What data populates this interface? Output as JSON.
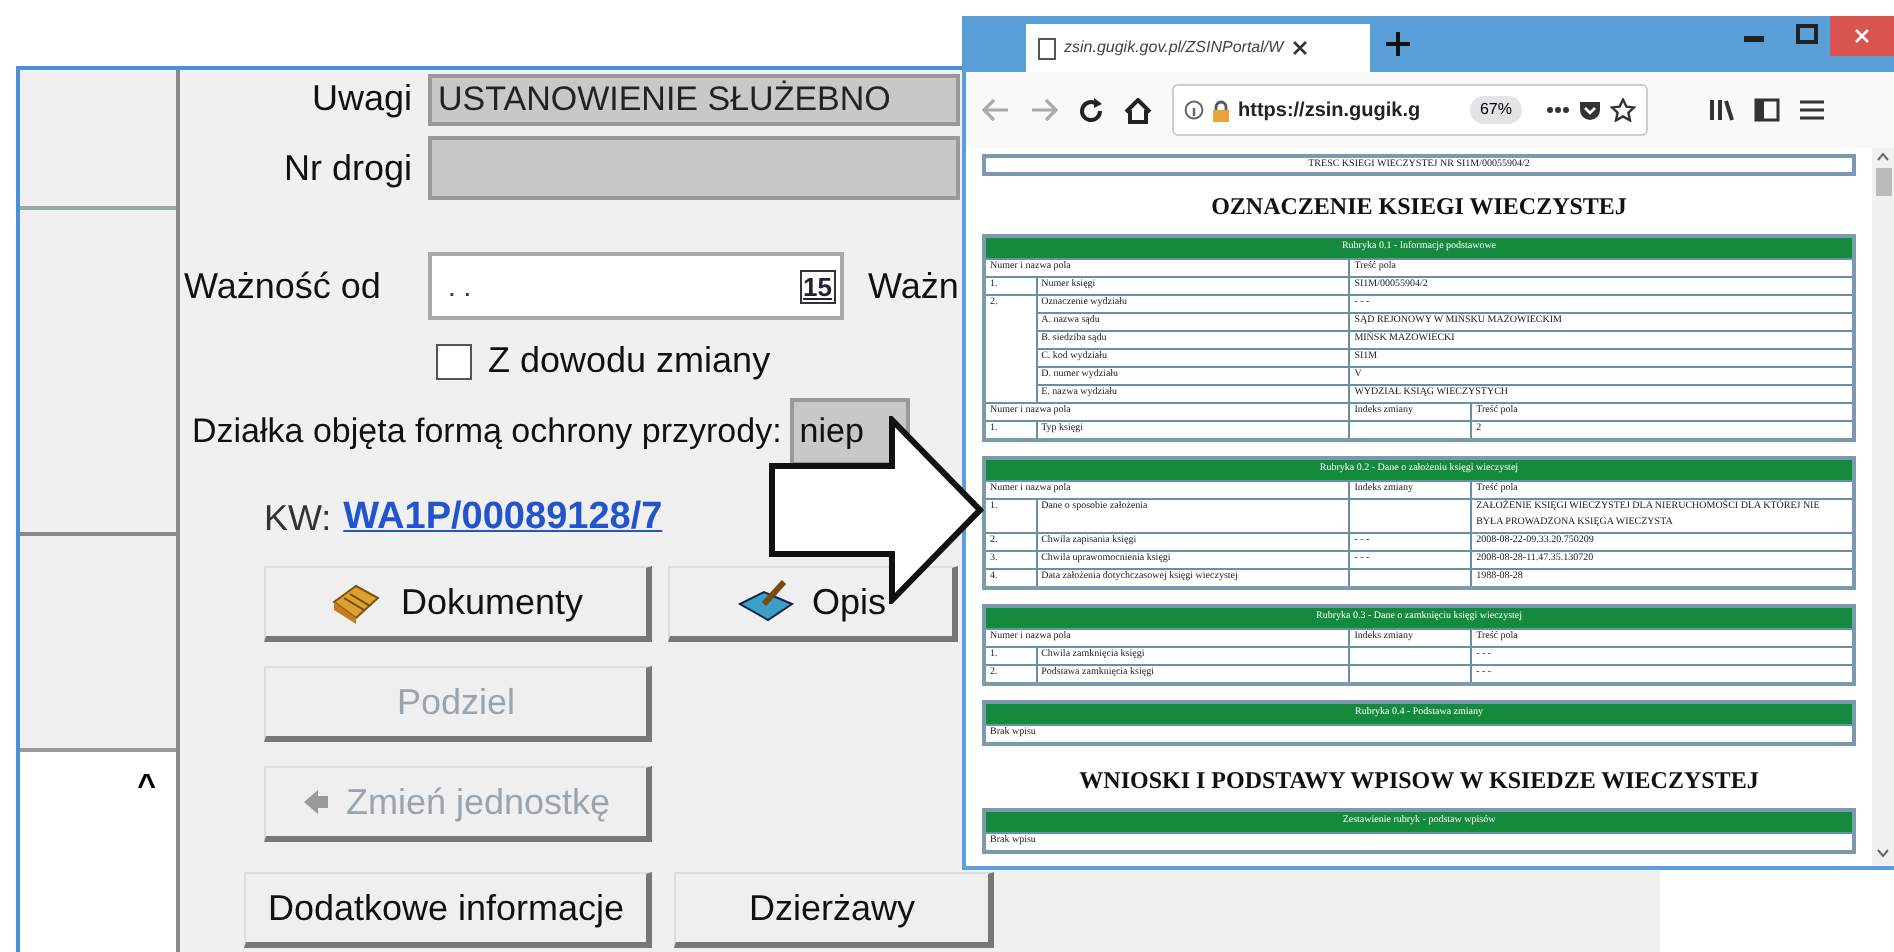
{
  "app": {
    "form": {
      "uwagi": {
        "label": "Uwagi",
        "value": "USTANOWIENIE SŁUŻEBNO"
      },
      "nr_drogi": {
        "label": "Nr drogi"
      },
      "waznosc_od": {
        "label": "Ważność od",
        "value": ". .",
        "calendar": "15"
      },
      "waznosc_do": {
        "label": "Ważn"
      },
      "z_dowodu_zmiany": {
        "label": "Z dowodu zmiany",
        "checked": false
      },
      "ochrona_przyrody": {
        "label": "Działka objęta formą ochrony przyrody:",
        "value": "niep"
      },
      "kw": {
        "label": "KW:",
        "link": "WA1P/00089128/7"
      }
    },
    "buttons": [
      {
        "label": "Dokumenty",
        "disabled": false
      },
      {
        "label": "Opis",
        "disabled": false
      },
      {
        "label": "Podziel",
        "disabled": true
      },
      {
        "label": "Zmień jednostkę",
        "disabled": true
      },
      {
        "label": "Dodatkowe informacje",
        "disabled": false
      },
      {
        "label": "Dzierżawy",
        "disabled": false
      }
    ],
    "side_scroll": "^"
  },
  "browser": {
    "tab_title": "zsin.gugik.gov.pl/ZSINPortal/W",
    "url": "https://zsin.gugik.g",
    "zoom": "67%",
    "document": [
      {
        "kind": "caption",
        "text": "TRESC KSIEGI WIECZYSTEJ NR SI1M/00055904/2"
      },
      {
        "kind": "heading",
        "text": "OZNACZENIE KSIEGI WIECZYSTEJ"
      },
      {
        "kind": "table",
        "title": "Rubryka 0.1 - Informacje podstawowe",
        "rows": [
          [
            {
              "text": "Numer i nazwa pola",
              "colspan": 2
            },
            {
              "text": "Treść pola",
              "colspan": 2
            }
          ],
          [
            {
              "text": "1."
            },
            {
              "text": "Numer księgi"
            },
            {
              "text": "SI1M/00055904/2",
              "colspan": 2
            }
          ],
          [
            {
              "text": "2.",
              "rowspan": 6
            },
            {
              "text": "Oznaczenie wydziału"
            },
            {
              "text": "- - -",
              "colspan": 2
            }
          ],
          [
            {
              "text": "A. nazwa sądu"
            },
            {
              "text": "SĄD REJONOWY W MIŃSKU MAZOWIECKIM",
              "colspan": 2
            }
          ],
          [
            {
              "text": "B. siedziba sądu"
            },
            {
              "text": "MIŃSK MAZOWIECKI",
              "colspan": 2
            }
          ],
          [
            {
              "text": "C. kod wydziału"
            },
            {
              "text": "SI1M",
              "colspan": 2
            }
          ],
          [
            {
              "text": "D. numer wydziału"
            },
            {
              "text": "V",
              "colspan": 2
            }
          ],
          [
            {
              "text": "E. nazwa wydziału"
            },
            {
              "text": "WYDZIAŁ KSIĄG WIECZYSTYCH",
              "colspan": 2
            }
          ],
          [
            {
              "text": "Numer i nazwa pola",
              "colspan": 2
            },
            {
              "text": "Indeks zmiany"
            },
            {
              "text": "Treść pola"
            }
          ],
          [
            {
              "text": "1."
            },
            {
              "text": "Typ księgi"
            },
            {},
            {
              "text": "2"
            }
          ]
        ]
      },
      {
        "kind": "table",
        "title": "Rubryka 0.2 - Dane o założeniu księgi wieczystej",
        "rows": [
          [
            {
              "text": "Numer i nazwa pola",
              "colspan": 2
            },
            {
              "text": "Indeks zmiany"
            },
            {
              "text": "Treść pola"
            }
          ],
          [
            {
              "text": "1."
            },
            {
              "text": "Dane o sposobie założenia"
            },
            {},
            {
              "text": "ZAŁOŻENIE KSIĘGI WIECZYSTEJ DLA NIERUCHOMOŚCI DLA KTÓREJ NIE BYŁA PROWADZONA KSIĘGA WIECZYSTA"
            }
          ],
          [
            {
              "text": "2."
            },
            {
              "text": "Chwila zapisania księgi"
            },
            {
              "text": "- - -"
            },
            {
              "text": "2008-08-22-09.33.20.750209"
            }
          ],
          [
            {
              "text": "3."
            },
            {
              "text": "Chwila uprawomocnienia księgi"
            },
            {
              "text": "- - -"
            },
            {
              "text": "2008-08-28-11.47.35.130720"
            }
          ],
          [
            {
              "text": "4."
            },
            {
              "text": "Data założenia dotychczasowej księgi wieczystej"
            },
            {},
            {
              "text": "1988-08-28"
            }
          ]
        ]
      },
      {
        "kind": "table",
        "title": "Rubryka 0.3 - Dane o zamknięciu księgi wieczystej",
        "rows": [
          [
            {
              "text": "Numer i nazwa pola",
              "colspan": 2
            },
            {
              "text": "Indeks zmiany"
            },
            {
              "text": "Treść pola"
            }
          ],
          [
            {
              "text": "1."
            },
            {
              "text": "Chwila zamknięcia księgi"
            },
            {},
            {
              "text": "- - -"
            }
          ],
          [
            {
              "text": "2."
            },
            {
              "text": "Podstawa zamknięcia księgi"
            },
            {},
            {
              "text": "- - -"
            }
          ]
        ]
      },
      {
        "kind": "table",
        "title": "Rubryka 0.4 - Podstawa zmiany",
        "rows": [
          [
            {
              "text": "Brak wpisu",
              "colspan": 4
            }
          ]
        ]
      },
      {
        "kind": "heading",
        "text": "WNIOSKI I PODSTAWY WPISOW W KSIEDZE WIECZYSTEJ"
      },
      {
        "kind": "table",
        "title": "Zestawienie rubryk - podstaw wpisów",
        "rows": [
          [
            {
              "text": "Brak wpisu",
              "colspan": 4
            }
          ]
        ]
      }
    ]
  }
}
